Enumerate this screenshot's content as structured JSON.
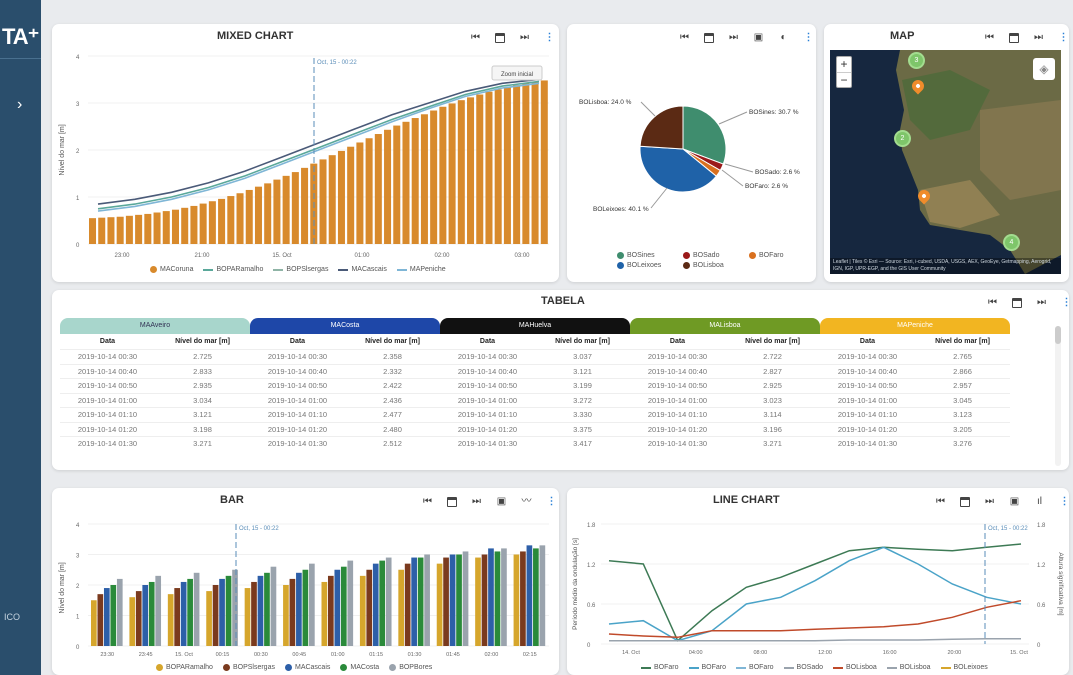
{
  "sidebar": {
    "logo": "TA⁺",
    "toggle": "›",
    "footer": "ICO"
  },
  "mixed": {
    "title": "MIXED CHART",
    "ylabel": "Nível do mar [m]",
    "yticks": [
      "4",
      "3",
      "2",
      "1",
      "0"
    ],
    "xticks": [
      "23:00",
      "21:00",
      "15. Oct",
      "01:00",
      "02:00",
      "03:00"
    ],
    "marker": "Oct, 15 - 00:22",
    "zoom_label": "Zoom inicial",
    "legend": [
      {
        "name": "MACoruna",
        "color": "#d88a2c",
        "kind": "dot"
      },
      {
        "name": "BOPARamalho",
        "color": "#5aa89a",
        "kind": "line"
      },
      {
        "name": "BOPSlsergas",
        "color": "#8fb4a6",
        "kind": "line"
      },
      {
        "name": "MACascais",
        "color": "#4a5a78",
        "kind": "line"
      },
      {
        "name": "MAPeniche",
        "color": "#7fb6d6",
        "kind": "line"
      }
    ]
  },
  "chart_data": [
    {
      "type": "bar",
      "title": "MIXED CHART",
      "ylabel": "Nível do mar [m]",
      "ylim": [
        0,
        4
      ],
      "series": [
        {
          "name": "MACoruna",
          "kind": "bar",
          "values": [
            0.55,
            0.56,
            0.57,
            0.58,
            0.6,
            0.62,
            0.64,
            0.67,
            0.7,
            0.73,
            0.77,
            0.81,
            0.86,
            0.91,
            0.96,
            1.02,
            1.08,
            1.15,
            1.22,
            1.29,
            1.37,
            1.45,
            1.53,
            1.62,
            1.71,
            1.8,
            1.89,
            1.98,
            2.07,
            2.16,
            2.25,
            2.34,
            2.43,
            2.52,
            2.6,
            2.68,
            2.76,
            2.84,
            2.92,
            2.99,
            3.06,
            3.12,
            3.18,
            3.24,
            3.29,
            3.34,
            3.38,
            3.42,
            3.45,
            3.48
          ]
        },
        {
          "name": "MACascais",
          "kind": "line",
          "values": [
            0.85,
            0.95,
            1.1,
            1.3,
            1.55,
            1.85,
            2.15,
            2.45,
            2.75,
            3.0,
            3.25,
            3.42,
            3.5
          ]
        },
        {
          "name": "BOPARamalho",
          "kind": "line",
          "values": [
            0.75,
            0.85,
            1.0,
            1.2,
            1.45,
            1.75,
            2.05,
            2.35,
            2.65,
            2.92,
            3.18,
            3.36,
            3.46
          ]
        },
        {
          "name": "MAPeniche",
          "kind": "line",
          "values": [
            0.7,
            0.8,
            0.95,
            1.15,
            1.4,
            1.7,
            2.0,
            2.3,
            2.6,
            2.88,
            3.14,
            3.32,
            3.42
          ]
        }
      ]
    },
    {
      "type": "pie",
      "slices": [
        {
          "name": "BOLisboa",
          "value": 24.0,
          "color": "#5b2a14"
        },
        {
          "name": "BOSines",
          "value": 30.7,
          "color": "#3f8d6e"
        },
        {
          "name": "BOSado",
          "value": 2.6,
          "color": "#9b1a1a"
        },
        {
          "name": "BOFaro",
          "value": 2.6,
          "color": "#d9701f"
        },
        {
          "name": "BOLeixoes",
          "value": 40.1,
          "color": "#1f62a8"
        }
      ]
    },
    {
      "type": "bar",
      "title": "BAR",
      "ylabel": "Nível do mar [m]",
      "ylim": [
        0,
        4
      ],
      "categories": [
        "23:30",
        "23:45",
        "15. Oct",
        "00:15",
        "00:30",
        "00:45",
        "01:00",
        "01:15",
        "01:30",
        "01:45",
        "02:00",
        "02:15"
      ],
      "series": [
        {
          "name": "BOPARamalho",
          "color": "#d6a62c",
          "values": [
            1.5,
            1.6,
            1.7,
            1.8,
            1.9,
            2.0,
            2.1,
            2.3,
            2.5,
            2.7,
            2.9,
            3.0
          ]
        },
        {
          "name": "BOPSlsergas",
          "color": "#7a3a1e",
          "values": [
            1.7,
            1.8,
            1.9,
            2.0,
            2.1,
            2.2,
            2.3,
            2.5,
            2.7,
            2.9,
            3.0,
            3.1
          ]
        },
        {
          "name": "MACascais",
          "color": "#2d5fa8",
          "values": [
            1.9,
            2.0,
            2.1,
            2.2,
            2.3,
            2.4,
            2.5,
            2.7,
            2.9,
            3.0,
            3.2,
            3.3
          ]
        },
        {
          "name": "MACosta",
          "color": "#2a8a3a",
          "values": [
            2.0,
            2.1,
            2.2,
            2.3,
            2.4,
            2.5,
            2.6,
            2.8,
            2.9,
            3.0,
            3.1,
            3.2
          ]
        },
        {
          "name": "BOPBores",
          "color": "#9aa3ad",
          "values": [
            2.2,
            2.3,
            2.4,
            2.5,
            2.6,
            2.7,
            2.8,
            2.9,
            3.0,
            3.1,
            3.2,
            3.3
          ]
        }
      ]
    },
    {
      "type": "line",
      "title": "LINE CHART",
      "ylabel": "Período médio da ondulação [s]",
      "y2label": "Altura significativa [m]",
      "ylim": [
        0,
        1.8
      ],
      "x": [
        "14. Oct",
        "04:00",
        "08:00",
        "12:00",
        "16:00",
        "20:00",
        "15. Oct"
      ],
      "series": [
        {
          "name": "BOFaro",
          "color": "#3d7a55",
          "values": [
            1.25,
            1.2,
            0.05,
            0.5,
            0.85,
            1.0,
            1.2,
            1.4,
            1.45,
            1.42,
            1.4,
            1.45,
            1.5
          ]
        },
        {
          "name": "BOFaro",
          "color": "#4aa3c8",
          "values": [
            0.3,
            0.35,
            0.05,
            0.2,
            0.6,
            0.7,
            0.95,
            1.25,
            1.45,
            1.2,
            0.9,
            0.7,
            0.6
          ]
        },
        {
          "name": "BOLisboa",
          "color": "#c04a2a",
          "values": [
            0.15,
            0.12,
            0.1,
            0.2,
            0.2,
            0.2,
            0.22,
            0.24,
            0.26,
            0.3,
            0.4,
            0.55,
            0.65
          ]
        },
        {
          "name": "BOSado",
          "color": "#9aa3ad",
          "values": [
            0.05,
            0.05,
            0.05,
            0.05,
            0.05,
            0.05,
            0.05,
            0.06,
            0.06,
            0.06,
            0.07,
            0.08,
            0.08
          ]
        }
      ]
    }
  ],
  "pie": {
    "labels": {
      "lisboa": "BOLisboa: 24.0 %",
      "sines": "BOSines: 30.7 %",
      "sado": "BOSado: 2.6 %",
      "faro": "BOFaro: 2.6 %",
      "leixoes": "BOLeixoes: 40.1 %"
    },
    "legend": [
      {
        "name": "BOSines",
        "color": "#3f8d6e"
      },
      {
        "name": "BOSado",
        "color": "#9b1a1a"
      },
      {
        "name": "BOFaro",
        "color": "#d9701f"
      },
      {
        "name": "BOLeixoes",
        "color": "#1f62a8"
      },
      {
        "name": "BOLisboa",
        "color": "#5b2a14"
      }
    ]
  },
  "map": {
    "title": "MAP",
    "zoom_in": "+",
    "zoom_out": "−",
    "clusters": [
      "3",
      "2",
      "4"
    ],
    "attribution": "Leaflet | Tiles © Esri — Source: Esri, i-cubed, USDA, USGS, AEX, GeoEye, Getmapping, Aerogrid, IGN, IGP, UPR-EGP, and the GIS User Community"
  },
  "tabela": {
    "title": "TABELA",
    "groups": [
      {
        "name": "MAAveiro",
        "bg": "#a8d6cc",
        "fg": "#335"
      },
      {
        "name": "MACosta",
        "bg": "#1e47a8",
        "fg": "#fff"
      },
      {
        "name": "MAHuelva",
        "bg": "#111111",
        "fg": "#fff"
      },
      {
        "name": "MALisboa",
        "bg": "#6f9a24",
        "fg": "#fff"
      },
      {
        "name": "MAPeniche",
        "bg": "#f2b521",
        "fg": "#fff"
      }
    ],
    "col_date": "Data",
    "col_level": "Nível do mar [m]",
    "rows": [
      [
        "2019-10-14 00:30",
        "2.725",
        "2019-10-14 00:30",
        "2.358",
        "2019-10-14 00:30",
        "3.037",
        "2019-10-14 00:30",
        "2.722",
        "2019-10-14 00:30",
        "2.765"
      ],
      [
        "2019-10-14 00:40",
        "2.833",
        "2019-10-14 00:40",
        "2.332",
        "2019-10-14 00:40",
        "3.121",
        "2019-10-14 00:40",
        "2.827",
        "2019-10-14 00:40",
        "2.866"
      ],
      [
        "2019-10-14 00:50",
        "2.935",
        "2019-10-14 00:50",
        "2.422",
        "2019-10-14 00:50",
        "3.199",
        "2019-10-14 00:50",
        "2.925",
        "2019-10-14 00:50",
        "2.957"
      ],
      [
        "2019-10-14 01:00",
        "3.034",
        "2019-10-14 01:00",
        "2.436",
        "2019-10-14 01:00",
        "3.272",
        "2019-10-14 01:00",
        "3.023",
        "2019-10-14 01:00",
        "3.045"
      ],
      [
        "2019-10-14 01:10",
        "3.121",
        "2019-10-14 01:10",
        "2.477",
        "2019-10-14 01:10",
        "3.330",
        "2019-10-14 01:10",
        "3.114",
        "2019-10-14 01:10",
        "3.123"
      ],
      [
        "2019-10-14 01:20",
        "3.198",
        "2019-10-14 01:20",
        "2.480",
        "2019-10-14 01:20",
        "3.375",
        "2019-10-14 01:20",
        "3.196",
        "2019-10-14 01:20",
        "3.205"
      ],
      [
        "2019-10-14 01:30",
        "3.271",
        "2019-10-14 01:30",
        "2.512",
        "2019-10-14 01:30",
        "3.417",
        "2019-10-14 01:30",
        "3.271",
        "2019-10-14 01:30",
        "3.276"
      ]
    ]
  },
  "bar": {
    "title": "BAR",
    "ylabel": "Nível do mar [m]",
    "yticks": [
      "4",
      "3",
      "2",
      "1",
      "0"
    ],
    "marker": "Oct, 15 - 00:22",
    "legend": [
      {
        "name": "BOPARamalho",
        "color": "#d6a62c"
      },
      {
        "name": "BOPSlsergas",
        "color": "#7a3a1e"
      },
      {
        "name": "MACascais",
        "color": "#2d5fa8"
      },
      {
        "name": "MACosta",
        "color": "#2a8a3a"
      },
      {
        "name": "BOPBores",
        "color": "#9aa3ad"
      }
    ]
  },
  "line": {
    "title": "LINE CHART",
    "yticks": [
      "1.8",
      "1.2",
      "0.6",
      "0"
    ],
    "y2ticks": [
      "1.8",
      "1.2",
      "0.6",
      "0"
    ],
    "marker": "Oct, 15 - 00:22",
    "legend": [
      {
        "name": "BOFaro",
        "color": "#3d7a55"
      },
      {
        "name": "BOFaro",
        "color": "#4aa3c8"
      },
      {
        "name": "BOFaro",
        "color": "#7fb6d6"
      },
      {
        "name": "BOSado",
        "color": "#9aa3ad"
      },
      {
        "name": "BOLisboa",
        "color": "#c04a2a"
      },
      {
        "name": "BOLisboa",
        "color": "#9aa3ad"
      },
      {
        "name": "BOLeixoes",
        "color": "#d6a62c"
      }
    ]
  }
}
